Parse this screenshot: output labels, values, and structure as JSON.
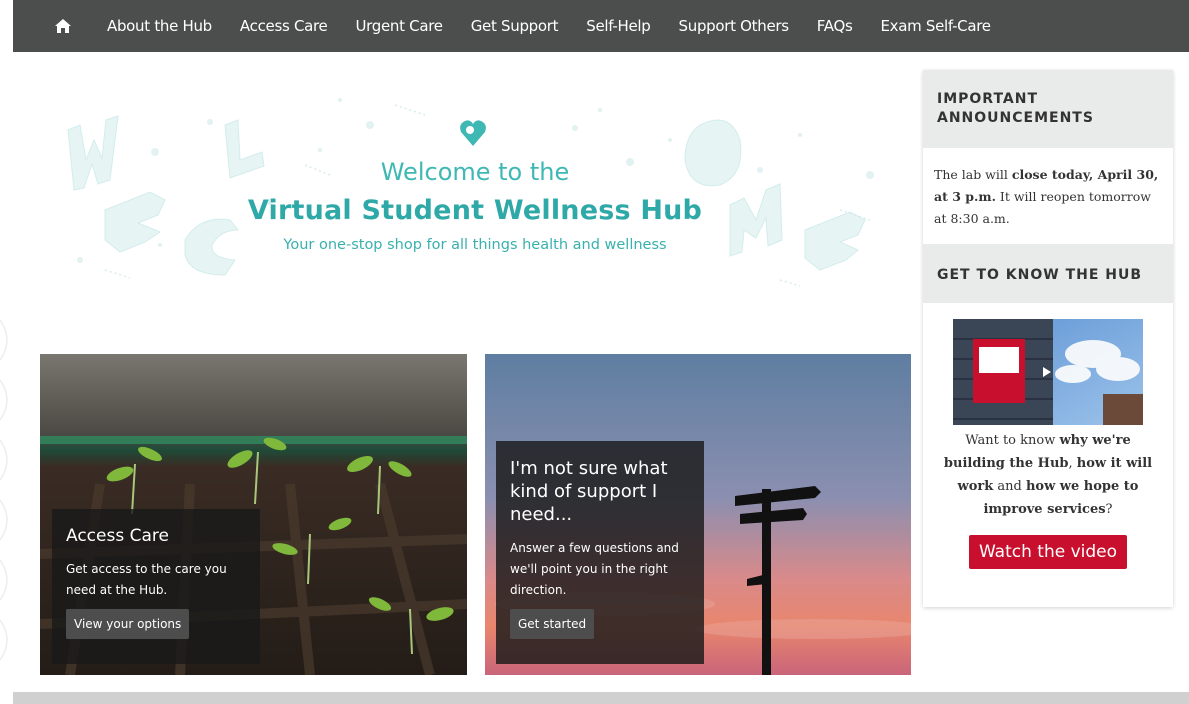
{
  "nav": {
    "home_icon": "home-icon",
    "items": [
      {
        "label": "About the Hub"
      },
      {
        "label": "Access Care"
      },
      {
        "label": "Urgent Care"
      },
      {
        "label": "Get Support"
      },
      {
        "label": "Self-Help"
      },
      {
        "label": "Support Others"
      },
      {
        "label": "FAQs"
      },
      {
        "label": "Exam Self-Care"
      }
    ]
  },
  "hero": {
    "line1": "Welcome to the",
    "line2": "Virtual Student Wellness Hub",
    "line3": "Your one-stop shop for all things health and wellness",
    "icon": "heart-pin-icon",
    "accent_color": "#3fb8b4"
  },
  "cards": [
    {
      "title": "Access Care",
      "description": "Get access to the care you need at the Hub.",
      "button": "View your options"
    },
    {
      "title": "I'm not sure what kind of support I need...",
      "description": "Answer a few questions and we'll point you in the right direction.",
      "button": "Get started"
    }
  ],
  "sidebar": {
    "announcements": {
      "heading": "IMPORTANT ANNOUNCEMENTS",
      "text_a": "The lab will ",
      "text_b": "close today, April 30, at 3 p.m.",
      "text_c": " It will reopen tomorrow at 8:30 a.m."
    },
    "get_to_know": {
      "heading": "GET TO KNOW THE HUB",
      "t1": "Want to know ",
      "t2": "why we're building the Hub",
      "t3": ", ",
      "t4": "how it will work",
      "t5": " and ",
      "t6": "how we hope to improve services",
      "t7": "?",
      "button": "Watch the video",
      "button_color": "#c8102e"
    }
  }
}
